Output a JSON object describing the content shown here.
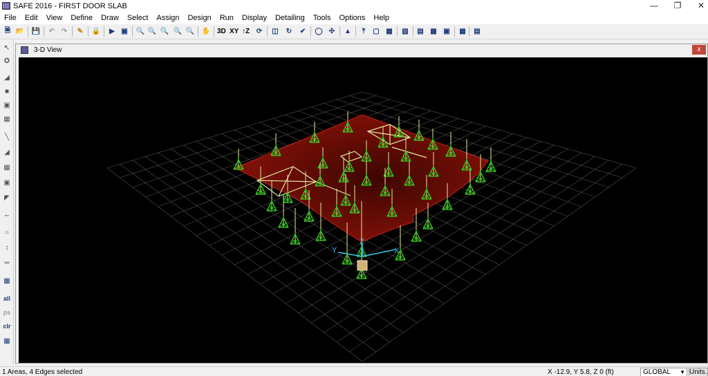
{
  "window": {
    "title": "SAFE 2016 - FIRST DOOR SLAB"
  },
  "menu": [
    "File",
    "Edit",
    "View",
    "Define",
    "Draw",
    "Select",
    "Assign",
    "Design",
    "Run",
    "Display",
    "Detailing",
    "Tools",
    "Options",
    "Help"
  ],
  "toolbar": {
    "btn_3d": "3D",
    "btn_xy": "XY",
    "btn_yz": "↑Z",
    "icons": [
      "new-file-icon",
      "open-folder-icon",
      "save-icon",
      "undo-icon",
      "redo-icon",
      "pencil-icon",
      "lock-icon",
      "run-icon",
      "animate-icon",
      "zoom-window-icon",
      "zoom-restore-icon",
      "zoom-in-icon",
      "zoom-out-icon",
      "zoom-previous-icon",
      "pan-icon",
      "rotate-icon",
      "perspective-icon",
      "refresh-icon",
      "checkmark-icon",
      "circle-icon",
      "move-icon",
      "triangle-icon",
      "arrow-up-icon",
      "display-icon",
      "grid-icon"
    ]
  },
  "left_toolbar": {
    "all": "all",
    "ps": "ps",
    "clr": "clr"
  },
  "view": {
    "title": "3-D View",
    "close": "x"
  },
  "axes": {
    "x": "X",
    "y": "Y",
    "z": "Z"
  },
  "status": {
    "selection": "1 Areas, 4 Edges selected",
    "coords": "X -12.9,  Y 5.8,  Z 0  (ft)",
    "coord_system": "GLOBAL",
    "units_button": "Units..."
  },
  "colors": {
    "slab": "#8a1208",
    "support": "#33d11d",
    "beam": "#e8e8a0",
    "grid": "#6e6e6e",
    "axis": "#38c8e8"
  }
}
